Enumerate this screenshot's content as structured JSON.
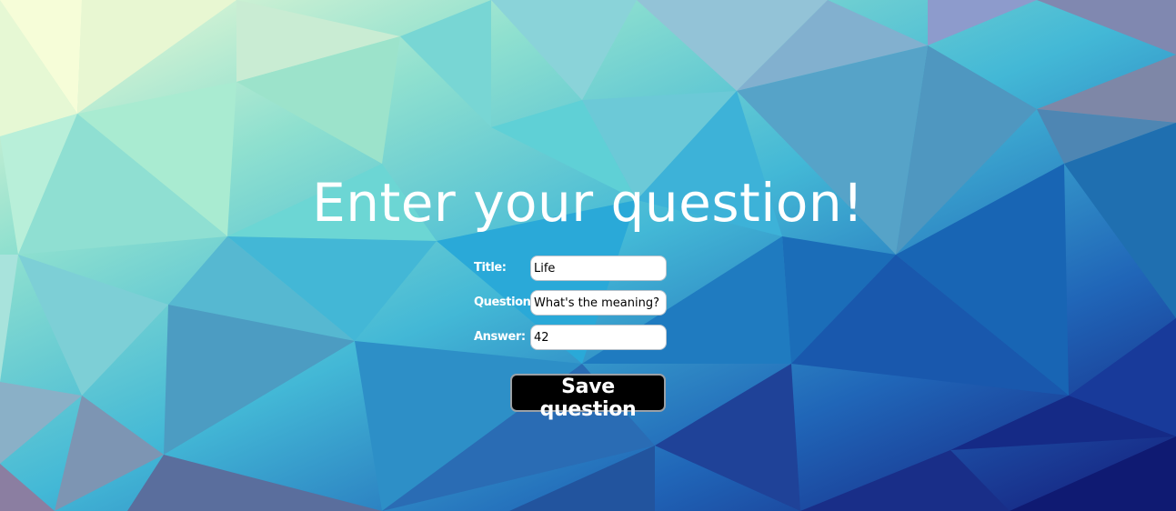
{
  "heading": "Enter your question!",
  "form": {
    "title_label": "Title:",
    "title_value": "Life",
    "question_label": "Question:",
    "question_value": "What's the meaning?",
    "answer_label": "Answer:",
    "answer_value": "42"
  },
  "save_button_label": "Save question",
  "colors": {
    "text": "#ffffff",
    "button_bg": "#000000",
    "field_bg": "#ffffff"
  }
}
